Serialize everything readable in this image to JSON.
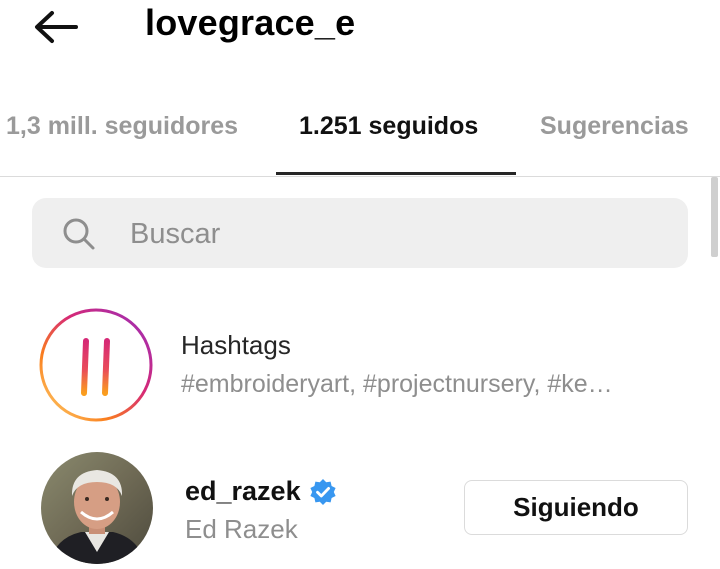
{
  "header": {
    "title": "lovegrace_e",
    "back_icon": "arrow-left-icon"
  },
  "tabs": [
    {
      "label": "1,3 mill. seguidores",
      "active": false
    },
    {
      "label": "1.251 seguidos",
      "active": true
    },
    {
      "label": "Sugerencias",
      "active": false
    }
  ],
  "search": {
    "placeholder": "Buscar",
    "value": "",
    "icon": "search-icon"
  },
  "hashtags": {
    "title": "Hashtags",
    "subtitle": "#embroideryart, #projectnursery, #ke…",
    "icon": "hashtag-icon"
  },
  "users": [
    {
      "handle": "ed_razek",
      "full_name": "Ed Razek",
      "verified": true,
      "button_label": "Siguiendo"
    }
  ],
  "colors": {
    "active_tab": "#111111",
    "inactive_tab": "#9a9a9a",
    "verified_blue": "#3897f0",
    "search_bg": "#efefef"
  }
}
